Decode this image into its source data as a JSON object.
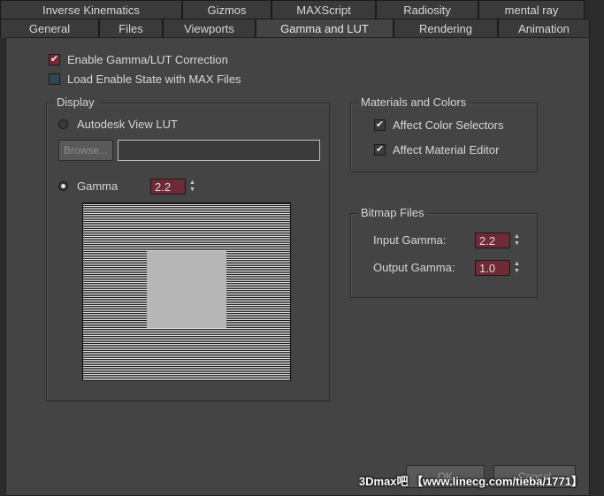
{
  "tabs": {
    "row1": [
      "Inverse Kinematics",
      "Gizmos",
      "MAXScript",
      "Radiosity",
      "mental ray"
    ],
    "row2": [
      "General",
      "Files",
      "Viewports",
      "Gamma and LUT",
      "Rendering",
      "Animation"
    ],
    "active": "Gamma and LUT"
  },
  "options": {
    "enable_gamma": "Enable Gamma/LUT Correction",
    "load_state": "Load Enable State with MAX Files"
  },
  "display": {
    "title": "Display",
    "lut_label": "Autodesk View LUT",
    "browse_label": "Browse...",
    "lut_path": "",
    "gamma_label": "Gamma",
    "gamma_value": "2.2"
  },
  "materials": {
    "title": "Materials and Colors",
    "affect_color_selectors": "Affect Color Selectors",
    "affect_material_editor": "Affect Material Editor"
  },
  "bitmap": {
    "title": "Bitmap Files",
    "input_label": "Input Gamma:",
    "input_value": "2.2",
    "output_label": "Output Gamma:",
    "output_value": "1.0"
  },
  "footer": {
    "ok_label": "OK",
    "cancel_label": "Cancel",
    "watermark": "3Dmax吧 【www.linecg.com/tieba/1771】"
  },
  "colors": {
    "spinner_bg": "#6e2a37",
    "panel_bg": "#444444"
  }
}
